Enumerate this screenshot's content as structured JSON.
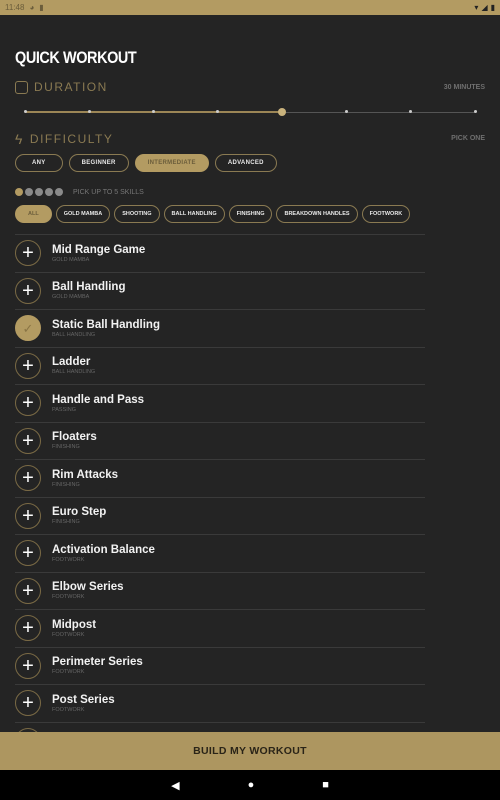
{
  "status_bar": {
    "time": "11:48"
  },
  "title": "QUICK WORKOUT",
  "duration": {
    "label": "DURATION",
    "value": "30 MINUTES",
    "stops": 8,
    "selected_index": 4
  },
  "difficulty": {
    "label": "DIFFICULTY",
    "hint": "PICK ONE",
    "options": [
      "ANY",
      "BEGINNER",
      "INTERMEDIATE",
      "ADVANCED"
    ],
    "selected": "INTERMEDIATE"
  },
  "skills": {
    "hint": "PICK UP TO 5 SKILLS",
    "picked": 1,
    "max": 5,
    "filters": [
      "ALL",
      "GOLD MAMBA",
      "SHOOTING",
      "BALL HANDLING",
      "FINISHING",
      "BREAKDOWN HANDLES",
      "FOOTWORK"
    ],
    "selected_filter": "ALL"
  },
  "drills": [
    {
      "name": "Mid Range Game",
      "category": "GOLD MAMBA",
      "selected": false
    },
    {
      "name": "Ball Handling",
      "category": "GOLD MAMBA",
      "selected": false
    },
    {
      "name": "Static Ball Handling",
      "category": "BALL HANDLING",
      "selected": true
    },
    {
      "name": "Ladder",
      "category": "BALL HANDLING",
      "selected": false
    },
    {
      "name": "Handle and Pass",
      "category": "PASSING",
      "selected": false
    },
    {
      "name": "Floaters",
      "category": "FINISHING",
      "selected": false
    },
    {
      "name": "Rim Attacks",
      "category": "FINISHING",
      "selected": false
    },
    {
      "name": "Euro Step",
      "category": "FINISHING",
      "selected": false
    },
    {
      "name": "Activation Balance",
      "category": "FOOTWORK",
      "selected": false
    },
    {
      "name": "Elbow Series",
      "category": "FOOTWORK",
      "selected": false
    },
    {
      "name": "Midpost",
      "category": "FOOTWORK",
      "selected": false
    },
    {
      "name": "Perimeter Series",
      "category": "FOOTWORK",
      "selected": false
    },
    {
      "name": "Post Series",
      "category": "FOOTWORK",
      "selected": false
    }
  ],
  "build_button": "BUILD MY WORKOUT",
  "colors": {
    "accent": "#b39b62",
    "background": "#242424"
  }
}
